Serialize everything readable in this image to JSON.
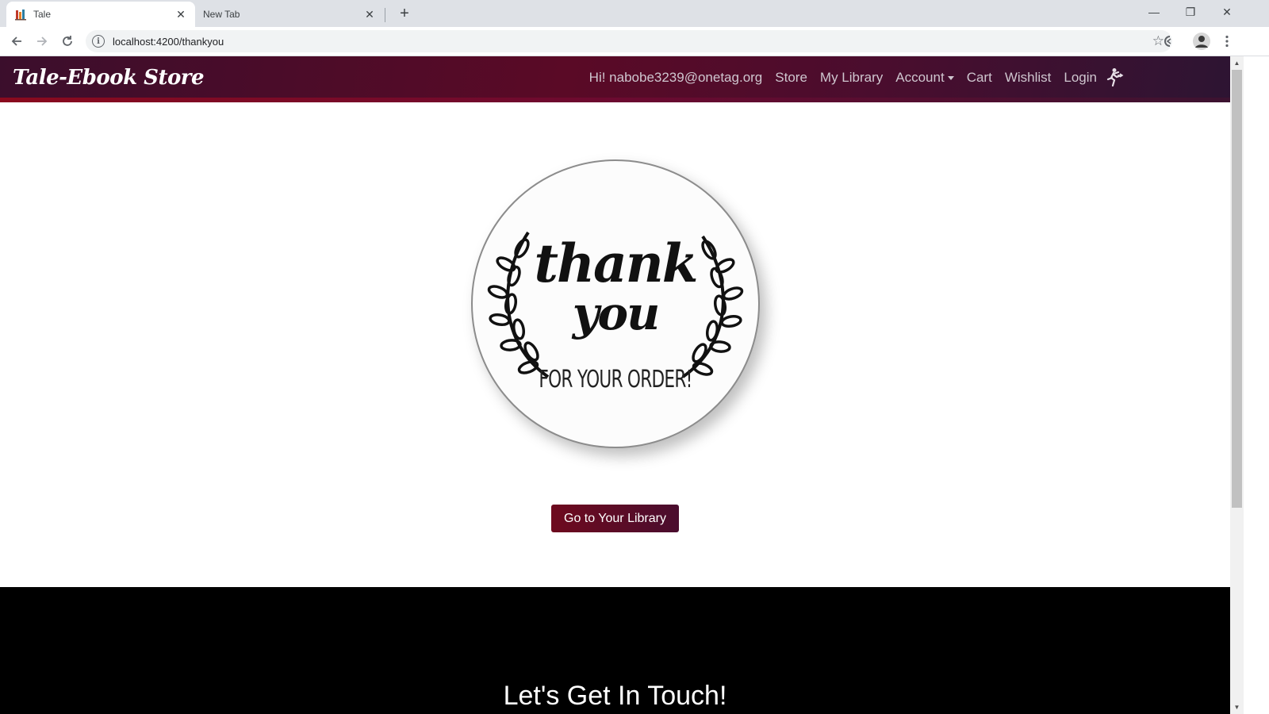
{
  "browser": {
    "tabs": [
      {
        "title": "Tale",
        "active": true
      },
      {
        "title": "New Tab",
        "active": false
      }
    ],
    "new_tab_symbol": "+",
    "url": "localhost:4200/thankyou",
    "window_controls": {
      "minimize": "—",
      "restore": "❐",
      "close": "✕"
    },
    "icons": [
      "back-arrow-icon",
      "forward-arrow-icon",
      "reload-icon",
      "info-icon",
      "star-icon",
      "extension-icon",
      "profile-avatar-icon",
      "kebab-menu-icon"
    ]
  },
  "navbar": {
    "brand": "Tale-Ebook Store",
    "greeting": "Hi! nabobe3239@onetag.org",
    "items": {
      "store": "Store",
      "library": "My Library",
      "account": "Account",
      "cart": "Cart",
      "wishlist": "Wishlist",
      "login": "Login"
    },
    "colors": {
      "gradient_start": "#3b0e2c",
      "gradient_mid": "#5a0a26",
      "accent_red": "#8a0a1e"
    }
  },
  "thankyou": {
    "line1": "thank",
    "line2": "you",
    "line3": "FOR YOUR ORDER!"
  },
  "cta": {
    "label": "Go to Your Library"
  },
  "footer": {
    "title": "Let's Get In Touch!"
  }
}
